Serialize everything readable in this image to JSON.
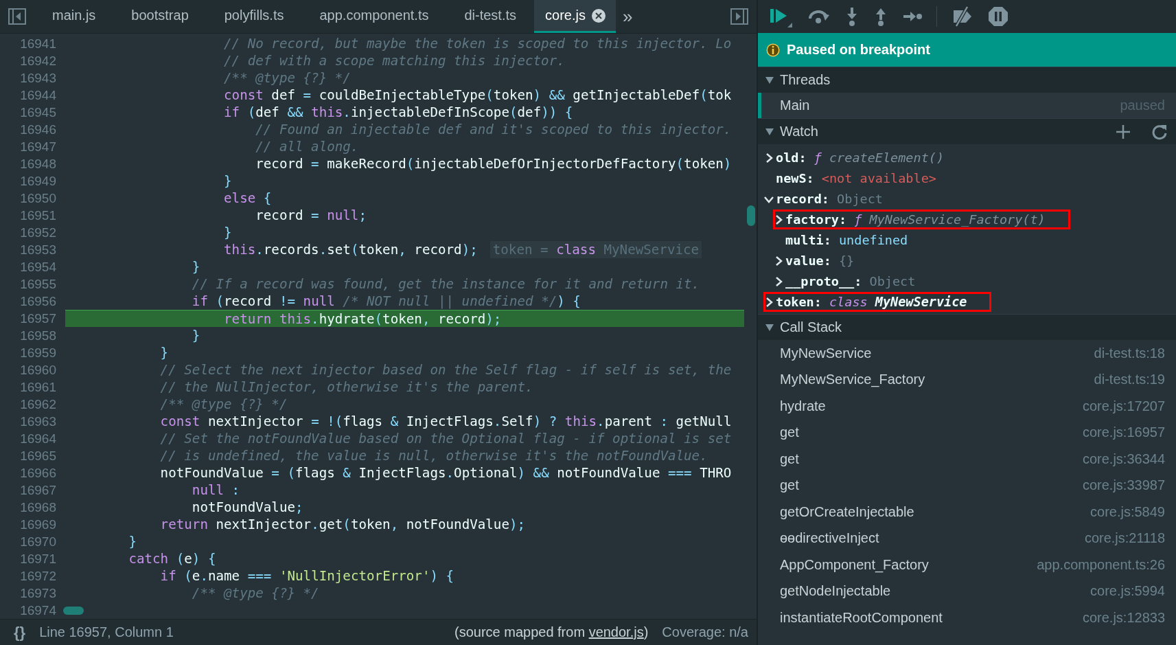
{
  "editor": {
    "tabs": [
      {
        "label": "main.js",
        "selected": false
      },
      {
        "label": "bootstrap",
        "selected": false
      },
      {
        "label": "polyfills.ts",
        "selected": false
      },
      {
        "label": "app.component.ts",
        "selected": false
      },
      {
        "label": "di-test.ts",
        "selected": false
      },
      {
        "label": "core.js",
        "selected": true
      }
    ],
    "overflow": "»",
    "code": {
      "lines": [
        {
          "number": "16941",
          "current": false,
          "tokens": [
            {
              "kind": "comment",
              "text": "                    // No record, but maybe the token is scoped to this injector. Lo"
            }
          ]
        },
        {
          "number": "16942",
          "current": false,
          "tokens": [
            {
              "kind": "comment",
              "text": "                    // def with a scope matching this injector."
            }
          ]
        },
        {
          "number": "16943",
          "current": false,
          "tokens": [
            {
              "kind": "comment",
              "text": "                    /** @type {?} */"
            }
          ]
        },
        {
          "number": "16944",
          "current": false,
          "tokens": [
            {
              "kind": "keyword",
              "text": "                    const"
            },
            {
              "kind": "ident",
              "text": " def "
            },
            {
              "kind": "punct",
              "text": "= "
            },
            {
              "kind": "ident",
              "text": "couldBeInjectableType"
            },
            {
              "kind": "punct",
              "text": "("
            },
            {
              "kind": "ident",
              "text": "token"
            },
            {
              "kind": "punct",
              "text": ") && "
            },
            {
              "kind": "ident",
              "text": "getInjectableDef"
            },
            {
              "kind": "punct",
              "text": "("
            },
            {
              "kind": "ident",
              "text": "tok"
            }
          ]
        },
        {
          "number": "16945",
          "current": false,
          "tokens": [
            {
              "kind": "keyword",
              "text": "                    if"
            },
            {
              "kind": "punct",
              "text": " ("
            },
            {
              "kind": "ident",
              "text": "def "
            },
            {
              "kind": "punct",
              "text": "&& "
            },
            {
              "kind": "keyword",
              "text": "this"
            },
            {
              "kind": "punct",
              "text": "."
            },
            {
              "kind": "ident",
              "text": "injectableDefInScope"
            },
            {
              "kind": "punct",
              "text": "("
            },
            {
              "kind": "ident",
              "text": "def"
            },
            {
              "kind": "punct",
              "text": ")) {"
            }
          ]
        },
        {
          "number": "16946",
          "current": false,
          "tokens": [
            {
              "kind": "comment",
              "text": "                        // Found an injectable def and it's scoped to this injector."
            }
          ]
        },
        {
          "number": "16947",
          "current": false,
          "tokens": [
            {
              "kind": "comment",
              "text": "                        // all along."
            }
          ]
        },
        {
          "number": "16948",
          "current": false,
          "tokens": [
            {
              "kind": "ident",
              "text": "                        record "
            },
            {
              "kind": "punct",
              "text": "= "
            },
            {
              "kind": "ident",
              "text": "makeRecord"
            },
            {
              "kind": "punct",
              "text": "("
            },
            {
              "kind": "ident",
              "text": "injectableDefOrInjectorDefFactory"
            },
            {
              "kind": "punct",
              "text": "("
            },
            {
              "kind": "ident",
              "text": "token"
            },
            {
              "kind": "punct",
              "text": ")"
            }
          ]
        },
        {
          "number": "16949",
          "current": false,
          "tokens": [
            {
              "kind": "punct",
              "text": "                    }"
            }
          ]
        },
        {
          "number": "16950",
          "current": false,
          "tokens": [
            {
              "kind": "keyword",
              "text": "                    else "
            },
            {
              "kind": "punct",
              "text": "{"
            }
          ]
        },
        {
          "number": "16951",
          "current": false,
          "tokens": [
            {
              "kind": "ident",
              "text": "                        record "
            },
            {
              "kind": "punct",
              "text": "= "
            },
            {
              "kind": "keyword",
              "text": "null"
            },
            {
              "kind": "punct",
              "text": ";"
            }
          ]
        },
        {
          "number": "16952",
          "current": false,
          "tokens": [
            {
              "kind": "punct",
              "text": "                    }"
            }
          ]
        },
        {
          "number": "16953",
          "current": false,
          "tokens": [
            {
              "kind": "keyword",
              "text": "                    this"
            },
            {
              "kind": "punct",
              "text": "."
            },
            {
              "kind": "ident",
              "text": "records"
            },
            {
              "kind": "punct",
              "text": "."
            },
            {
              "kind": "ident",
              "text": "set"
            },
            {
              "kind": "punct",
              "text": "("
            },
            {
              "kind": "ident",
              "text": "token"
            },
            {
              "kind": "punct",
              "text": ", "
            },
            {
              "kind": "ident",
              "text": "record"
            },
            {
              "kind": "punct",
              "text": ");"
            }
          ],
          "hint": [
            {
              "kind": "hint",
              "text": "token = "
            },
            {
              "kind": "keyword",
              "text": "class"
            },
            {
              "kind": "hint",
              "text": " MyNewService"
            }
          ]
        },
        {
          "number": "16954",
          "current": false,
          "tokens": [
            {
              "kind": "punct",
              "text": "                }"
            }
          ]
        },
        {
          "number": "16955",
          "current": false,
          "tokens": [
            {
              "kind": "comment",
              "text": "                // If a record was found, get the instance for it and return it."
            }
          ]
        },
        {
          "number": "16956",
          "current": false,
          "tokens": [
            {
              "kind": "keyword",
              "text": "                if"
            },
            {
              "kind": "punct",
              "text": " ("
            },
            {
              "kind": "ident",
              "text": "record "
            },
            {
              "kind": "punct",
              "text": "!= "
            },
            {
              "kind": "keyword",
              "text": "null "
            },
            {
              "kind": "comment",
              "text": "/* NOT null || undefined */"
            },
            {
              "kind": "punct",
              "text": ") {"
            }
          ]
        },
        {
          "number": "16957",
          "current": true,
          "tokens": [
            {
              "kind": "keyword",
              "text": "                    return this"
            },
            {
              "kind": "punct",
              "text": "."
            },
            {
              "kind": "ident",
              "text": "hydrate"
            },
            {
              "kind": "punct",
              "text": "("
            },
            {
              "kind": "ident",
              "text": "token"
            },
            {
              "kind": "punct",
              "text": ", "
            },
            {
              "kind": "ident",
              "text": "record"
            },
            {
              "kind": "punct",
              "text": ");"
            }
          ]
        },
        {
          "number": "16958",
          "current": false,
          "tokens": [
            {
              "kind": "punct",
              "text": "                }"
            }
          ]
        },
        {
          "number": "16959",
          "current": false,
          "tokens": [
            {
              "kind": "punct",
              "text": "            }"
            }
          ]
        },
        {
          "number": "16960",
          "current": false,
          "tokens": [
            {
              "kind": "comment",
              "text": "            // Select the next injector based on the Self flag - if self is set, the"
            }
          ]
        },
        {
          "number": "16961",
          "current": false,
          "tokens": [
            {
              "kind": "comment",
              "text": "            // the NullInjector, otherwise it's the parent."
            }
          ]
        },
        {
          "number": "16962",
          "current": false,
          "tokens": [
            {
              "kind": "comment",
              "text": "            /** @type {?} */"
            }
          ]
        },
        {
          "number": "16963",
          "current": false,
          "tokens": [
            {
              "kind": "keyword",
              "text": "            const "
            },
            {
              "kind": "ident",
              "text": "nextInjector "
            },
            {
              "kind": "punct",
              "text": "= !("
            },
            {
              "kind": "ident",
              "text": "flags "
            },
            {
              "kind": "punct",
              "text": "& "
            },
            {
              "kind": "ident",
              "text": "InjectFlags"
            },
            {
              "kind": "punct",
              "text": "."
            },
            {
              "kind": "ident",
              "text": "Self"
            },
            {
              "kind": "punct",
              "text": ") ? "
            },
            {
              "kind": "keyword",
              "text": "this"
            },
            {
              "kind": "punct",
              "text": "."
            },
            {
              "kind": "ident",
              "text": "parent "
            },
            {
              "kind": "punct",
              "text": ": "
            },
            {
              "kind": "ident",
              "text": "getNull"
            }
          ]
        },
        {
          "number": "16964",
          "current": false,
          "tokens": [
            {
              "kind": "comment",
              "text": "            // Set the notFoundValue based on the Optional flag - if optional is set"
            }
          ]
        },
        {
          "number": "16965",
          "current": false,
          "tokens": [
            {
              "kind": "comment",
              "text": "            // is undefined, the value is null, otherwise it's the notFoundValue."
            }
          ]
        },
        {
          "number": "16966",
          "current": false,
          "tokens": [
            {
              "kind": "ident",
              "text": "            notFoundValue "
            },
            {
              "kind": "punct",
              "text": "= ("
            },
            {
              "kind": "ident",
              "text": "flags "
            },
            {
              "kind": "punct",
              "text": "& "
            },
            {
              "kind": "ident",
              "text": "InjectFlags"
            },
            {
              "kind": "punct",
              "text": "."
            },
            {
              "kind": "ident",
              "text": "Optional"
            },
            {
              "kind": "punct",
              "text": ") && "
            },
            {
              "kind": "ident",
              "text": "notFoundValue "
            },
            {
              "kind": "punct",
              "text": "=== "
            },
            {
              "kind": "ident",
              "text": "THRO"
            }
          ]
        },
        {
          "number": "16967",
          "current": false,
          "tokens": [
            {
              "kind": "keyword",
              "text": "                null "
            },
            {
              "kind": "punct",
              "text": ":"
            }
          ]
        },
        {
          "number": "16968",
          "current": false,
          "tokens": [
            {
              "kind": "ident",
              "text": "                notFoundValue"
            },
            {
              "kind": "punct",
              "text": ";"
            }
          ]
        },
        {
          "number": "16969",
          "current": false,
          "tokens": [
            {
              "kind": "keyword",
              "text": "            return "
            },
            {
              "kind": "ident",
              "text": "nextInjector"
            },
            {
              "kind": "punct",
              "text": "."
            },
            {
              "kind": "ident",
              "text": "get"
            },
            {
              "kind": "punct",
              "text": "("
            },
            {
              "kind": "ident",
              "text": "token"
            },
            {
              "kind": "punct",
              "text": ", "
            },
            {
              "kind": "ident",
              "text": "notFoundValue"
            },
            {
              "kind": "punct",
              "text": ");"
            }
          ]
        },
        {
          "number": "16970",
          "current": false,
          "tokens": [
            {
              "kind": "punct",
              "text": "        }"
            }
          ]
        },
        {
          "number": "16971",
          "current": false,
          "tokens": [
            {
              "kind": "keyword",
              "text": "        catch "
            },
            {
              "kind": "punct",
              "text": "("
            },
            {
              "kind": "ident",
              "text": "e"
            },
            {
              "kind": "punct",
              "text": ") {"
            }
          ]
        },
        {
          "number": "16972",
          "current": false,
          "tokens": [
            {
              "kind": "keyword",
              "text": "            if "
            },
            {
              "kind": "punct",
              "text": "("
            },
            {
              "kind": "ident",
              "text": "e"
            },
            {
              "kind": "punct",
              "text": "."
            },
            {
              "kind": "ident",
              "text": "name "
            },
            {
              "kind": "punct",
              "text": "=== "
            },
            {
              "kind": "string",
              "text": "'NullInjectorError'"
            },
            {
              "kind": "punct",
              "text": ") {"
            }
          ]
        },
        {
          "number": "16973",
          "current": false,
          "tokens": [
            {
              "kind": "comment",
              "text": "                /** @type {?} */"
            }
          ]
        },
        {
          "number": "16974"
        }
      ]
    },
    "status": {
      "format_button": "{}",
      "position": "Line 16957, Column 1",
      "source_prefix": "(source mapped from ",
      "source_link": "vendor.js",
      "source_suffix": ")",
      "coverage": "Coverage: n/a"
    }
  },
  "debugger": {
    "banner": "Paused on breakpoint",
    "threads": {
      "title": "Threads",
      "expanded": true,
      "items": [
        {
          "name": "Main",
          "status": "paused",
          "selected": true
        }
      ]
    },
    "watch": {
      "title": "Watch",
      "expanded": true,
      "items": [
        {
          "name": "old:",
          "kind": "function",
          "keyword": "ƒ",
          "value": "createElement()",
          "expanded": false,
          "highlighted": false
        },
        {
          "name": "newS:",
          "kind": "error",
          "value": "<not available>",
          "highlighted": false
        },
        {
          "name": "record:",
          "kind": "object",
          "value": "Object",
          "expanded": true,
          "highlighted": false,
          "children": [
            {
              "name": "factory:",
              "kind": "function",
              "keyword": "ƒ",
              "value": "MyNewService_Factory(t)",
              "expanded": false,
              "highlighted": true
            },
            {
              "name": "multi:",
              "kind": "undefined",
              "value": "undefined",
              "highlighted": false
            },
            {
              "name": "value:",
              "kind": "object",
              "value": "{}",
              "expanded": false,
              "highlighted": false
            },
            {
              "name": "__proto__:",
              "kind": "object",
              "value": "Object",
              "expanded": false,
              "highlighted": false
            }
          ]
        },
        {
          "name": "token:",
          "kind": "class",
          "keyword": "class",
          "value": "MyNewService",
          "expanded": false,
          "highlighted": true
        }
      ]
    },
    "call_stack": {
      "title": "Call Stack",
      "expanded": true,
      "frames": [
        {
          "function": "MyNewService",
          "location": "di-test.ts:18"
        },
        {
          "function": "MyNewService_Factory",
          "location": "di-test.ts:19"
        },
        {
          "function": "hydrate",
          "location": "core.js:17207"
        },
        {
          "function": "get",
          "location": "core.js:16957"
        },
        {
          "function": "get",
          "location": "core.js:36344"
        },
        {
          "function": "get",
          "location": "core.js:33987"
        },
        {
          "function": "getOrCreateInjectable",
          "location": "core.js:5849"
        },
        {
          "function": "ɵɵdirectiveInject",
          "location": "core.js:21118"
        },
        {
          "function": "AppComponent_Factory",
          "location": "app.component.ts:26"
        },
        {
          "function": "getNodeInjectable",
          "location": "core.js:5994"
        },
        {
          "function": "instantiateRootComponent",
          "location": "core.js:12833"
        }
      ]
    }
  }
}
